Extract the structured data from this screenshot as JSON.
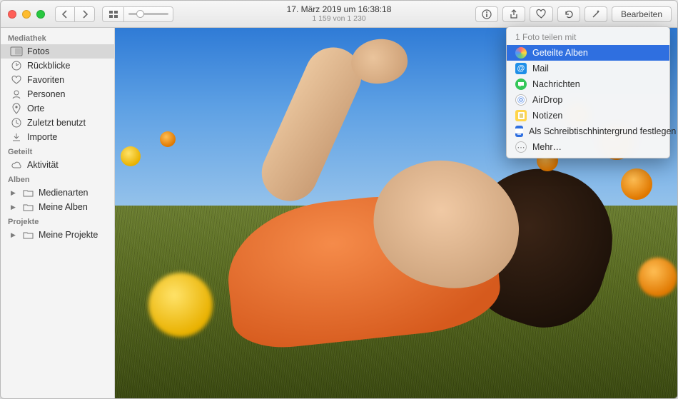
{
  "header": {
    "date_line": "17. März 2019 um 16:38:18",
    "count_line": "1 159 von 1 230",
    "edit_label": "Bearbeiten"
  },
  "sidebar": {
    "sections": {
      "library": "Mediathek",
      "shared": "Geteilt",
      "albums": "Alben",
      "projects": "Projekte"
    },
    "library_items": {
      "photos": "Fotos",
      "memories": "Rückblicke",
      "favorites": "Favoriten",
      "people": "Personen",
      "places": "Orte",
      "recent": "Zuletzt benutzt",
      "imports": "Importe"
    },
    "shared_items": {
      "activity": "Aktivität"
    },
    "album_items": {
      "mediatypes": "Medienarten",
      "myalbums": "Meine Alben"
    },
    "project_items": {
      "myprojects": "Meine Projekte"
    }
  },
  "share_menu": {
    "header": "1 Foto teilen mit",
    "items": {
      "shared_albums": "Geteilte Alben",
      "mail": "Mail",
      "messages": "Nachrichten",
      "airdrop": "AirDrop",
      "notes": "Notizen",
      "wallpaper": "Als Schreibtischhintergrund festlegen",
      "more": "Mehr…"
    }
  }
}
